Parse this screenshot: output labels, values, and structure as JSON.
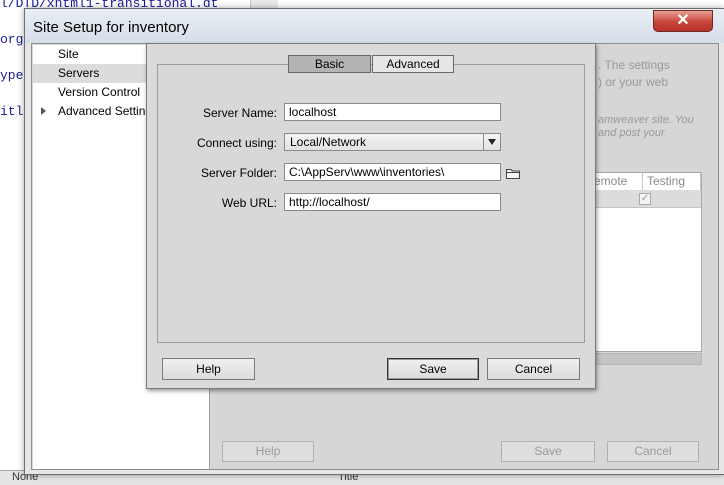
{
  "background_code": {
    "lines": [
      "l/DTD/xhtml1-transitional.dt",
      "org",
      "ype",
      "itl"
    ],
    "bottom_bar": {
      "left_text": "None",
      "right_text": "Title"
    }
  },
  "window": {
    "title": "Site Setup for inventory",
    "close_label": "✕"
  },
  "sidebar": {
    "items": [
      {
        "label": "Site"
      },
      {
        "label": "Servers"
      },
      {
        "label": "Version Control"
      },
      {
        "label": "Advanced Settings"
      }
    ],
    "selected": "Servers"
  },
  "background_panel": {
    "text_lines": [
      ". The settings",
      ") or your web",
      "amweaver site. You",
      "and post your"
    ],
    "table_headers": [
      "emote",
      "Testing"
    ],
    "buttons": {
      "help": "Help",
      "save": "Save",
      "cancel": "Cancel"
    }
  },
  "server_dialog": {
    "tabs": [
      {
        "label": "Basic",
        "active": true
      },
      {
        "label": "Advanced",
        "active": false
      }
    ],
    "fields": {
      "server_name": {
        "label": "Server Name:",
        "value": "localhost"
      },
      "connect_using": {
        "label": "Connect using:",
        "value": "Local/Network"
      },
      "server_folder": {
        "label": "Server Folder:",
        "value": "C:\\AppServ\\www\\inventories\\"
      },
      "web_url": {
        "label": "Web URL:",
        "value": "http://localhost/"
      }
    },
    "buttons": {
      "help": "Help",
      "save": "Save",
      "cancel": "Cancel"
    }
  },
  "colors": {
    "code_text": "#1a1a9c",
    "close_button": "#c7443a",
    "dialog_bg": "#dadada"
  }
}
